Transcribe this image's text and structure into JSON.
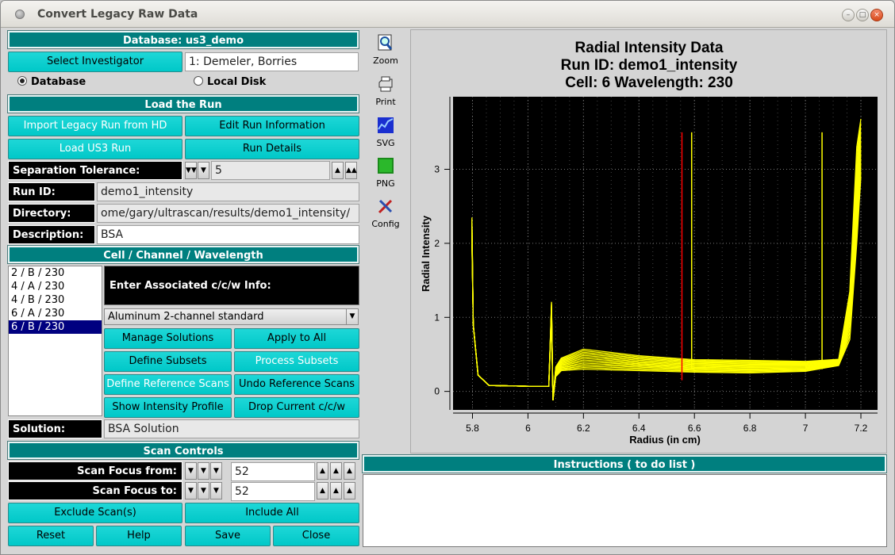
{
  "window": {
    "title": "Convert Legacy Raw Data"
  },
  "left": {
    "database_header": "Database: us3_demo",
    "select_investigator": "Select Investigator",
    "investigator_value": "1: Demeler, Borries",
    "radio_database": "Database",
    "radio_local": "Local Disk",
    "load_header": "Load the Run",
    "import_legacy": "Import Legacy Run from HD",
    "edit_run_info": "Edit Run Information",
    "load_us3": "Load US3 Run",
    "run_details": "Run Details",
    "sep_tol_label": "Separation Tolerance:",
    "sep_tol_value": "5",
    "run_id_label": "Run ID:",
    "run_id_value": "demo1_intensity",
    "dir_label": "Directory:",
    "dir_value": "ome/gary/ultrascan/results/demo1_intensity/",
    "desc_label": "Description:",
    "desc_value": "BSA",
    "ccw_header": "Cell / Channel / Wavelength",
    "ccw_items": [
      "2 / B / 230",
      "4 / A / 230",
      "4 / B / 230",
      "6 / A / 230",
      "6 / B / 230"
    ],
    "ccw_selected_index": 4,
    "enter_ccw": "Enter Associated c/c/w Info:",
    "centerpiece": "Aluminum 2-channel standard",
    "manage_solutions": "Manage Solutions",
    "apply_all": "Apply to All",
    "define_subsets": "Define Subsets",
    "process_subsets": "Process Subsets",
    "define_ref": "Define Reference Scans",
    "undo_ref": "Undo Reference Scans",
    "show_intensity": "Show Intensity Profile",
    "drop_ccw": "Drop Current c/c/w",
    "solution_label": "Solution:",
    "solution_value": "BSA Solution",
    "scan_header": "Scan Controls",
    "scan_from_label": "Scan Focus from:",
    "scan_from_value": "52",
    "scan_to_label": "Scan Focus to:",
    "scan_to_value": "52",
    "exclude_scans": "Exclude Scan(s)",
    "include_all": "Include All",
    "reset": "Reset",
    "help": "Help",
    "save": "Save",
    "close": "Close"
  },
  "toolbar": {
    "zoom": "Zoom",
    "print": "Print",
    "svg": "SVG",
    "png": "PNG",
    "config": "Config"
  },
  "plot": {
    "title1": "Radial Intensity Data",
    "title2": "Run ID: demo1_intensity",
    "title3": "Cell: 6 Wavelength: 230",
    "xlabel": "Radius (in cm)",
    "ylabel": "Radial Intensity",
    "xticks": [
      "5.8",
      "6",
      "6.2",
      "6.4",
      "6.6",
      "6.8",
      "7",
      "7.2"
    ],
    "yticks": [
      "0",
      "1",
      "2",
      "3"
    ]
  },
  "instructions": {
    "header": "Instructions ( to do list )"
  },
  "colors": {
    "teal": "#007f7f",
    "button": "#00c8c8",
    "trace": "#ffff00",
    "marker": "#ff0000"
  }
}
